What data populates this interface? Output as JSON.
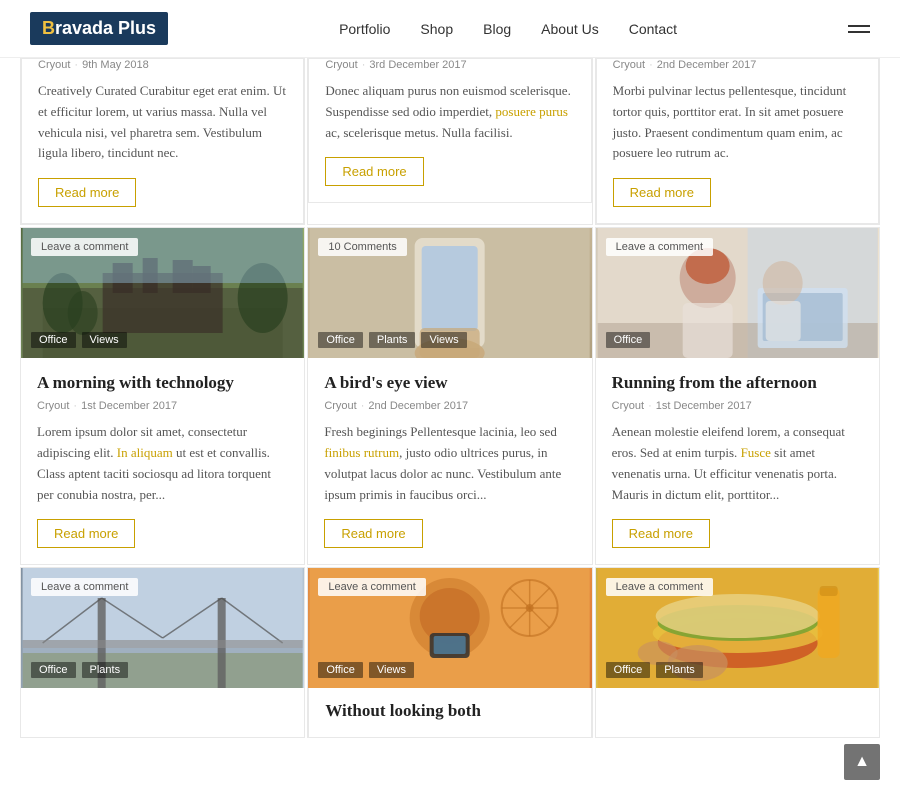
{
  "header": {
    "logo_text": "Bravada Plus",
    "logo_b": "B",
    "logo_rest": "ravada",
    "logo_plus": " Plus",
    "nav": [
      {
        "label": "Portfolio",
        "id": "portfolio"
      },
      {
        "label": "Shop",
        "id": "shop"
      },
      {
        "label": "Blog",
        "id": "blog"
      },
      {
        "label": "About Us",
        "id": "about"
      },
      {
        "label": "Contact",
        "id": "contact"
      }
    ]
  },
  "cards_row1_partial": [
    {
      "id": "card-top-1",
      "meta_author": "Cryout",
      "meta_date": "9th May 2018",
      "excerpt": "Creatively Curated Curabitur eget erat enim. Ut et efficitur lorem, ut varius massa. Nulla vel vehicula nisi, vel pharetra sem. Vestibulum ligula libero, tincidunt nec.",
      "read_more": "Read more"
    },
    {
      "id": "card-top-2",
      "meta_author": "Cryout",
      "meta_date": "3rd December 2017",
      "excerpt": "Donec aliquam purus non euismod scelerisque. Suspendisse sed odio imperdiet, posuere purus ac, scelerisque metus. Nulla facilisi.",
      "read_more": "Read more"
    },
    {
      "id": "card-top-3",
      "meta_author": "Cryout",
      "meta_date": "2nd December 2017",
      "excerpt": "Morbi pulvinar lectus pellentesque, tincidunt tortor quis, porttitor erat. In sit amet posuere justo. Praesent condimentum quam enim, ac posuere leo rutrum ac.",
      "read_more": "Read more"
    }
  ],
  "cards_row2": [
    {
      "id": "card-mid-1",
      "image_type": "castle",
      "comment_label": "Leave a comment",
      "tags": [
        "Office",
        "Views"
      ],
      "title": "A morning with technology",
      "meta_author": "Cryout",
      "meta_dot": "·",
      "meta_date": "1st December 2017",
      "excerpt": "Lorem ipsum dolor sit amet, consectetur adipiscing elit. In aliquam ut est et convallis. Class aptent taciti sociosqu ad litora torquent per conubia nostra, per...",
      "read_more": "Read more"
    },
    {
      "id": "card-mid-2",
      "image_type": "phone",
      "comment_label": "10 Comments",
      "tags": [
        "Office",
        "Plants",
        "Views"
      ],
      "title": "A bird's eye view",
      "meta_author": "Cryout",
      "meta_dot": "·",
      "meta_date": "2nd December 2017",
      "excerpt": "Fresh beginings Pellentesque lacinia, leo sed finibus rutrum, justo odio ultrices purus, in volutpat lacus dolor ac nunc. Vestibulum ante ipsum primis in faucibus orci...",
      "read_more": "Read more"
    },
    {
      "id": "card-mid-3",
      "image_type": "office",
      "comment_label": "Leave a comment",
      "tags": [
        "Office"
      ],
      "title": "Running from the afternoon",
      "meta_author": "Cryout",
      "meta_dot": "·",
      "meta_date": "1st December 2017",
      "excerpt": "Aenean molestie eleifend lorem, a consequat eros. Sed at enim turpis. Fusce sit amet venenatis urna. Ut efficitur venenatis porta. Mauris in dictum elit, porttitor...",
      "read_more": "Read more"
    }
  ],
  "cards_row3": [
    {
      "id": "card-bot-1",
      "image_type": "bridge",
      "comment_label": "Leave a comment",
      "tags": [
        "Office",
        "Plants"
      ],
      "title": "",
      "partial": true
    },
    {
      "id": "card-bot-2",
      "image_type": "phone2",
      "comment_label": "Leave a comment",
      "tags": [
        "Office",
        "Views"
      ],
      "title": "Without looking both",
      "partial": true
    },
    {
      "id": "card-bot-3",
      "image_type": "food",
      "comment_label": "Leave a comment",
      "tags": [
        "Office",
        "Plants"
      ],
      "title": "",
      "partial": true
    }
  ],
  "back_to_top": "▲"
}
